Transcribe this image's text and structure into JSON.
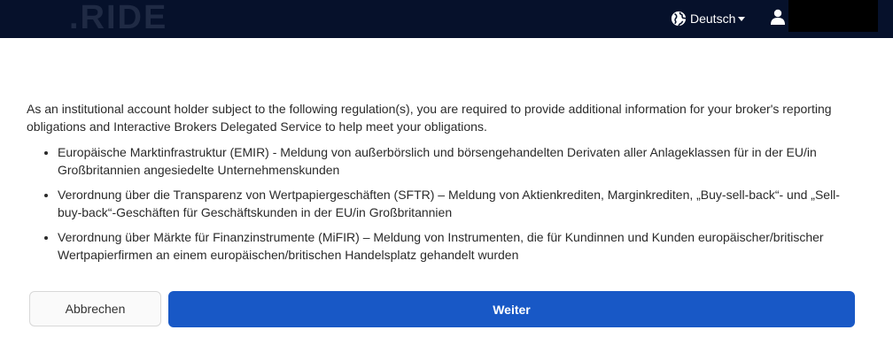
{
  "header": {
    "logo_text": ".RIDE",
    "language_label": "Deutsch",
    "globe_icon": "globe-icon",
    "user_icon": "user-icon",
    "colors": {
      "background": "#06112b",
      "logo": "#1f2a44"
    }
  },
  "main": {
    "intro": "As an institutional account holder subject to the following regulation(s), you are required to provide additional information for your broker's reporting obligations and Interactive Brokers Delegated Service to help meet your obligations.",
    "regulations": [
      "Europäische Marktinfrastruktur (EMIR) - Meldung von außerbörslich und börsengehandelten Derivaten aller Anlageklassen für in der EU/in Großbritannien angesiedelte Unternehmenskunden",
      "Verordnung über die Transparenz von Wertpapiergeschäften (SFTR) – Meldung von Aktienkrediten, Marginkrediten, „Buy-sell-back“- und „Sell-buy-back“-Geschäften für Geschäftskunden in der EU/in Großbritannien",
      "Verordnung über Märkte für Finanzinstrumente (MiFIR) – Meldung von Instrumenten, die für Kundinnen und Kunden europäischer/britischer Wertpapierfirmen an einem europäischen/britischen Handelsplatz gehandelt wurden"
    ]
  },
  "actions": {
    "cancel_label": "Abbrechen",
    "next_label": "Weiter",
    "colors": {
      "primary": "#1858c6"
    }
  }
}
